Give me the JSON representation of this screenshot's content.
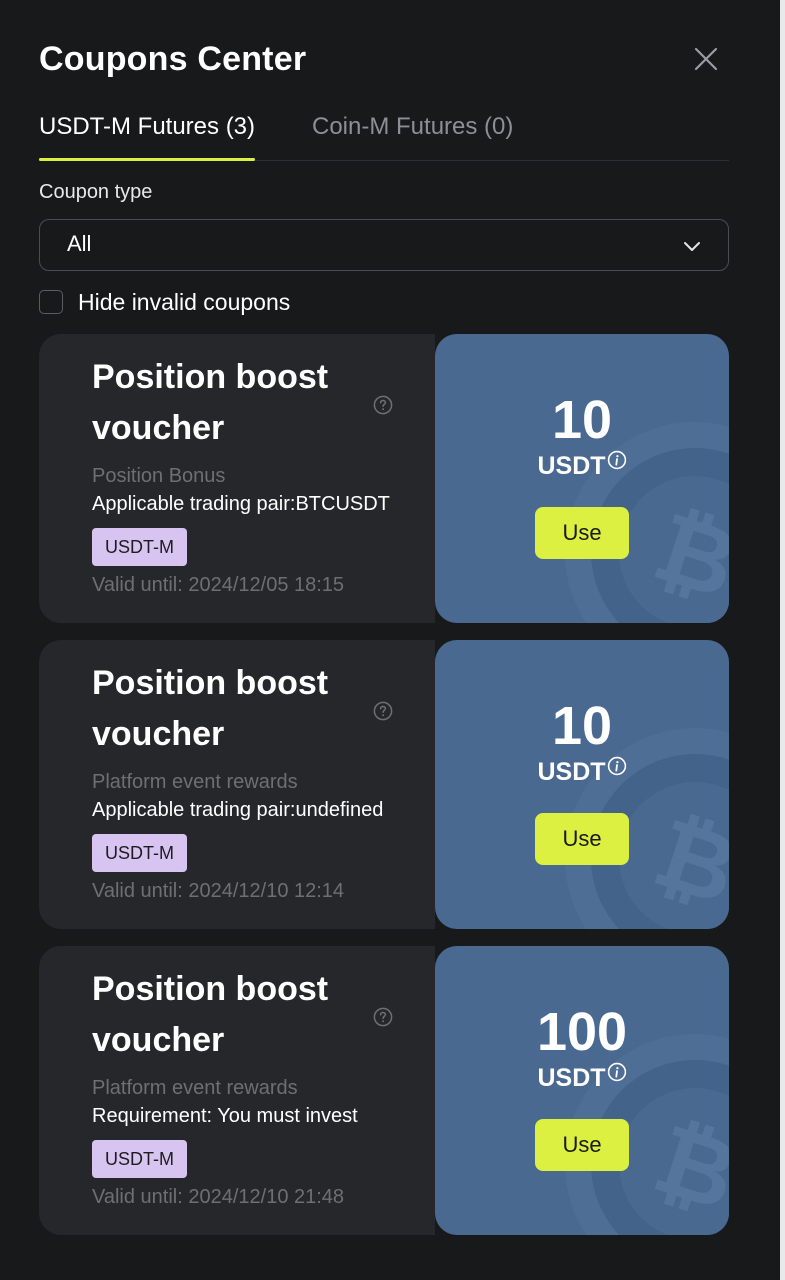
{
  "header": {
    "title": "Coupons Center",
    "close_icon": "close-icon"
  },
  "tabs": [
    {
      "label": "USDT-M Futures (3)",
      "active": true
    },
    {
      "label": "Coin-M Futures (0)",
      "active": false
    }
  ],
  "filter": {
    "label": "Coupon type",
    "selected": "All",
    "icon": "chevron-down-icon"
  },
  "hide_invalid": {
    "label": "Hide invalid coupons",
    "checked": false
  },
  "coupons": [
    {
      "title": "Position boost voucher",
      "source": "Position Bonus",
      "description": "Applicable trading pair:BTCUSDT",
      "badge": "USDT-M",
      "valid_until": "Valid until: 2024/12/05 18:15",
      "amount": "10",
      "unit": "USDT",
      "action": "Use"
    },
    {
      "title": "Position boost voucher",
      "source": "Platform event rewards",
      "description": "Applicable trading pair:undefined",
      "badge": "USDT-M",
      "valid_until": "Valid until: 2024/12/10 12:14",
      "amount": "10",
      "unit": "USDT",
      "action": "Use"
    },
    {
      "title": "Position boost voucher",
      "source": "Platform event rewards",
      "description": "Requirement: You must invest",
      "badge": "USDT-M",
      "valid_until": "Valid until: 2024/12/10 21:48",
      "amount": "100",
      "unit": "USDT",
      "action": "Use"
    }
  ],
  "colors": {
    "background": "#18191b",
    "card": "#26272b",
    "card_accent": "#4a6991",
    "accent": "#dcf041",
    "badge": "#d8c4f0",
    "muted_text": "#6d6f74"
  }
}
